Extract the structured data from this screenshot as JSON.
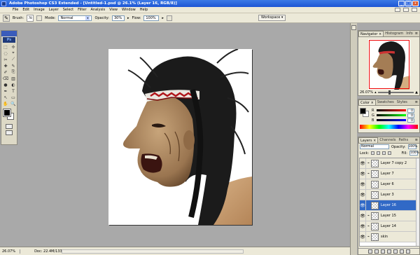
{
  "window": {
    "title": "Adobe Photoshop CS3 Extended - [Untitled-1.psd @ 26.1% (Layer 16, RGB/8)]",
    "minimize": "_",
    "maximize": "□",
    "close": "x"
  },
  "menu": [
    "File",
    "Edit",
    "Image",
    "Layer",
    "Select",
    "Filter",
    "Analysis",
    "View",
    "Window",
    "Help"
  ],
  "options": {
    "brush_label": "Brush:",
    "brush_size": "78",
    "mode_label": "Mode:",
    "mode_value": "Normal",
    "opacity_label": "Opacity:",
    "opacity_value": "30%",
    "flow_label": "Flow:",
    "flow_value": "100%",
    "workspace_label": "Workspace ▾"
  },
  "toolbox": {
    "logo": "Ps",
    "tools": [
      "⬚",
      "✢",
      "◌",
      "⌖",
      "✂",
      "⟋",
      "✚",
      "✎",
      "✐",
      "⎘",
      "⌫",
      "▥",
      "●",
      "◐",
      "✒",
      "T",
      "↖",
      "▭",
      "✋",
      "🔍"
    ]
  },
  "status": {
    "zoom": "26.07%",
    "doc": "Doc: 22.4M/133.4M",
    "arrow": "▸"
  },
  "navigator": {
    "tabs": [
      "Navigator ×",
      "Histogram",
      "Info"
    ],
    "menu": "≡",
    "zoom": "26.07%",
    "zoom_level": 0.3
  },
  "color": {
    "tabs": [
      "Color ×",
      "Swatches",
      "Styles"
    ],
    "menu": "≡",
    "channels": [
      {
        "label": "R",
        "value": "0",
        "track": "linear-gradient(90deg,#000,#f00)"
      },
      {
        "label": "G",
        "value": "0",
        "track": "linear-gradient(90deg,#000,#0f0)"
      },
      {
        "label": "B",
        "value": "0",
        "track": "linear-gradient(90deg,#000,#00f)"
      }
    ]
  },
  "layers": {
    "tabs": [
      "Layers ×",
      "Channels",
      "Paths"
    ],
    "menu": "≡",
    "blend_mode": "Normal",
    "opacity_label": "Opacity:",
    "opacity_value": "100%",
    "lock_label": "Lock:",
    "fill_label": "Fill:",
    "fill_value": "100%",
    "items": [
      {
        "name": "Layer 7 copy 2"
      },
      {
        "name": "Layer 7"
      },
      {
        "name": "Layer 6"
      },
      {
        "name": "Layer 3"
      },
      {
        "name": "Layer 16"
      },
      {
        "name": "Layer 15"
      },
      {
        "name": "Layer 14"
      },
      {
        "name": "skin"
      }
    ],
    "selected_index": 4
  }
}
